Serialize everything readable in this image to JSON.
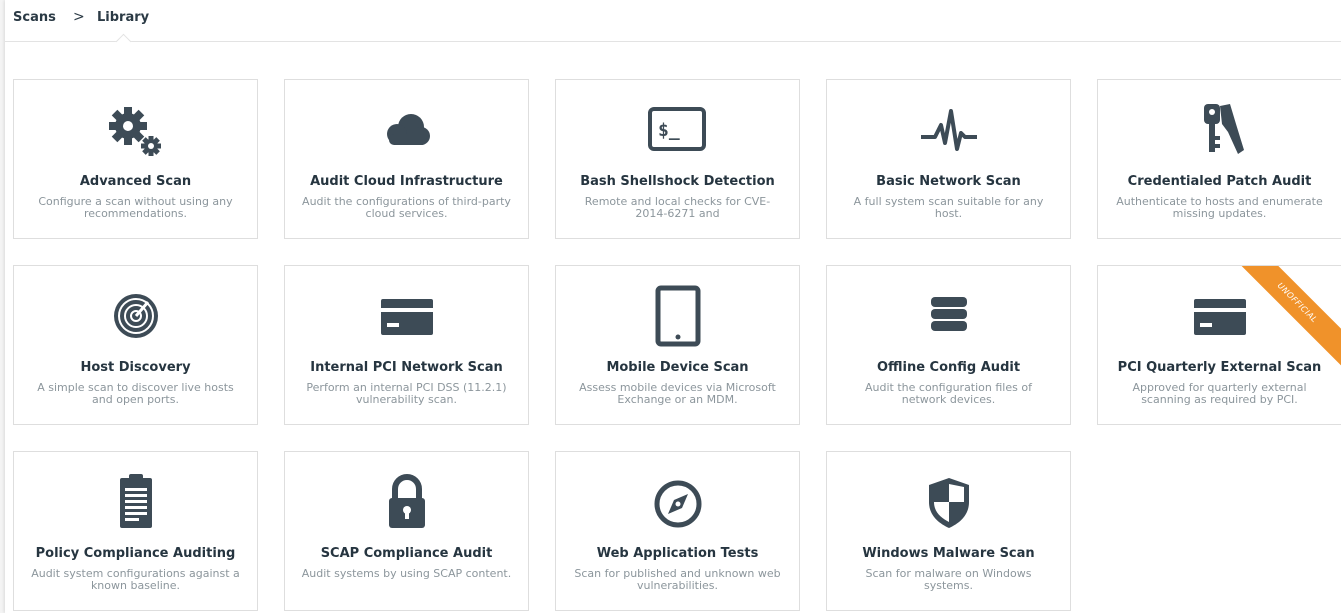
{
  "breadcrumb": {
    "root": "Scans",
    "separator": ">",
    "current": "Library"
  },
  "colors": {
    "icon": "#3d4b56",
    "ribbon": "#f0922a"
  },
  "templates": [
    {
      "title": "Advanced Scan",
      "description": "Configure a scan without using any recommendations.",
      "icon": "gears-icon"
    },
    {
      "title": "Audit Cloud Infrastructure",
      "description": "Audit the configurations of third-party cloud services.",
      "icon": "cloud-icon"
    },
    {
      "title": "Bash Shellshock Detection",
      "description": "Remote and local checks for CVE-2014-6271 and",
      "icon": "terminal-icon"
    },
    {
      "title": "Basic Network Scan",
      "description": "A full system scan suitable for any host.",
      "icon": "pulse-icon"
    },
    {
      "title": "Credentialed Patch Audit",
      "description": "Authenticate to hosts and enumerate missing updates.",
      "icon": "keys-icon"
    },
    {
      "title": "Host Discovery",
      "description": "A simple scan to discover live hosts and open ports.",
      "icon": "radar-icon"
    },
    {
      "title": "Internal PCI Network Scan",
      "description": "Perform an internal PCI DSS (11.2.1) vulnerability scan.",
      "icon": "credit-card-icon"
    },
    {
      "title": "Mobile Device Scan",
      "description": "Assess mobile devices via Microsoft Exchange or an MDM.",
      "icon": "tablet-icon"
    },
    {
      "title": "Offline Config Audit",
      "description": "Audit the configuration files of network devices.",
      "icon": "server-stack-icon"
    },
    {
      "title": "PCI Quarterly External Scan",
      "description": "Approved for quarterly external scanning as required by PCI.",
      "icon": "credit-card-icon",
      "badge": "UNOFFICIAL"
    },
    {
      "title": "Policy Compliance Auditing",
      "description": "Audit system configurations against a known baseline.",
      "icon": "clipboard-icon"
    },
    {
      "title": "SCAP Compliance Audit",
      "description": "Audit systems by using SCAP content.",
      "icon": "padlock-icon"
    },
    {
      "title": "Web Application Tests",
      "description": "Scan for published and unknown web vulnerabilities.",
      "icon": "compass-icon"
    },
    {
      "title": "Windows Malware Scan",
      "description": "Scan for malware on Windows systems.",
      "icon": "shield-icon"
    }
  ]
}
